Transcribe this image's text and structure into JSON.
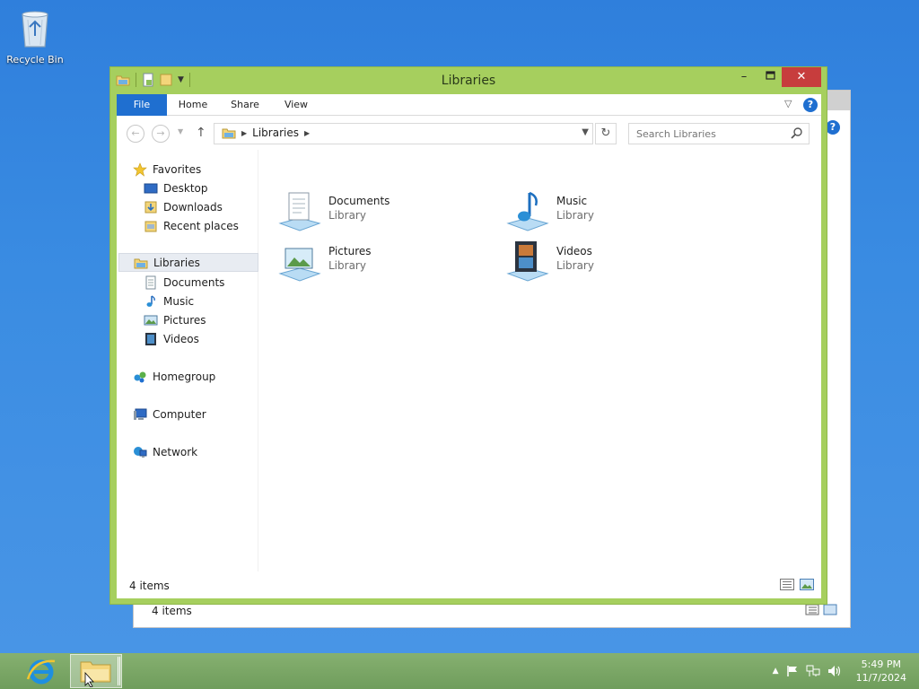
{
  "desktop": {
    "recycle_bin_label": "Recycle Bin"
  },
  "background_window": {
    "status_text": "4 items"
  },
  "window": {
    "title": "Libraries",
    "ribbon_tabs": [
      "File",
      "Home",
      "Share",
      "View"
    ],
    "help_label": "?",
    "address": {
      "crumb": "Libraries"
    },
    "search": {
      "placeholder": "Search Libraries"
    },
    "nav": {
      "favorites": {
        "label": "Favorites",
        "items": [
          "Desktop",
          "Downloads",
          "Recent places"
        ]
      },
      "libraries": {
        "label": "Libraries",
        "items": [
          "Documents",
          "Music",
          "Pictures",
          "Videos"
        ]
      },
      "homegroup": "Homegroup",
      "computer": "Computer",
      "network": "Network"
    },
    "files": [
      {
        "name": "Documents",
        "type": "Library",
        "icon": "documents-library-icon"
      },
      {
        "name": "Music",
        "type": "Library",
        "icon": "music-library-icon"
      },
      {
        "name": "Pictures",
        "type": "Library",
        "icon": "pictures-library-icon"
      },
      {
        "name": "Videos",
        "type": "Library",
        "icon": "videos-library-icon"
      }
    ],
    "status_text": "4 items"
  },
  "taskbar": {
    "time": "5:49 PM",
    "date": "11/7/2024"
  },
  "colors": {
    "window_frame": "#a6cf5e",
    "accent": "#1f6fd0",
    "close": "#c73d3d",
    "taskbar": "#7ca968",
    "desktop": "#3b8ae0"
  }
}
